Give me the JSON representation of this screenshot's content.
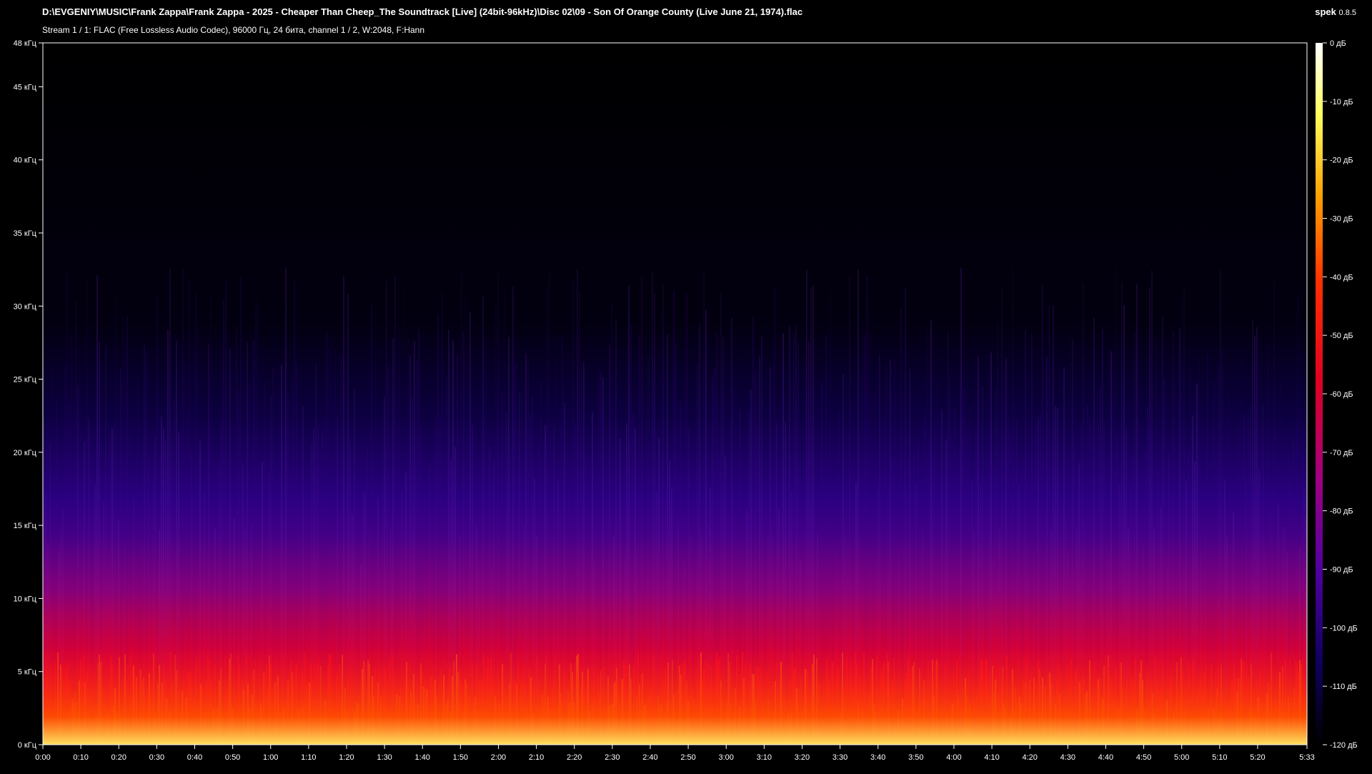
{
  "window": {
    "file_path": "D:\\EVGENIY\\MUSIC\\Frank Zappa\\Frank Zappa - 2025 - Cheaper Than Cheep_The Soundtrack [Live] (24bit-96kHz)\\Disc 02\\09 - Son Of Orange County (Live June 21, 1974).flac",
    "stream_info": "Stream 1 / 1: FLAC (Free Lossless Audio Codec), 96000 Гц, 24 бита, channel 1 / 2, W:2048, F:Hann",
    "app_name": "spek",
    "app_version": "0.8.5"
  },
  "frequency_axis": {
    "unit": "кГц",
    "max_khz": 48,
    "ticks": [
      "0 кГц",
      "5 кГц",
      "10 кГц",
      "15 кГц",
      "20 кГц",
      "25 кГц",
      "30 кГц",
      "35 кГц",
      "40 кГц",
      "45 кГц",
      "48 кГц"
    ]
  },
  "time_axis": {
    "duration_s": 333,
    "ticks": [
      "0:00",
      "0:10",
      "0:20",
      "0:30",
      "0:40",
      "0:50",
      "1:00",
      "1:10",
      "1:20",
      "1:30",
      "1:40",
      "1:50",
      "2:00",
      "2:10",
      "2:20",
      "2:30",
      "2:40",
      "2:50",
      "3:00",
      "3:10",
      "3:20",
      "3:30",
      "3:40",
      "3:50",
      "4:00",
      "4:10",
      "4:20",
      "4:30",
      "4:40",
      "4:50",
      "5:00",
      "5:10",
      "5:20",
      "5:33"
    ]
  },
  "level_scale": {
    "unit": "дБ",
    "ticks": [
      "0 дБ",
      "-10 дБ",
      "-20 дБ",
      "-30 дБ",
      "-40 дБ",
      "-50 дБ",
      "-60 дБ",
      "-70 дБ",
      "-80 дБ",
      "-90 дБ",
      "-100 дБ",
      "-110 дБ",
      "-120 дБ"
    ],
    "colors": [
      "#ffffff",
      "#ffff80",
      "#ffc000",
      "#ff6000",
      "#e00020",
      "#a00080",
      "#5000a0",
      "#100060",
      "#000000"
    ]
  }
}
